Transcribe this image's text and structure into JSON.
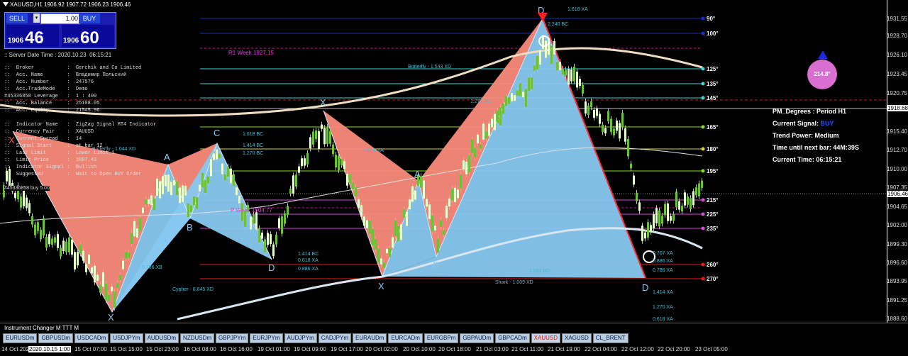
{
  "window": {
    "title": "XAUUSD,H1  1906.92 1907.72 1906.23 1906.46"
  },
  "trade_panel": {
    "sell_label": "SELL",
    "buy_label": "BUY",
    "lot": "1.00",
    "sell_small": "1906",
    "sell_big": "46",
    "buy_small": "1906",
    "buy_big": "60"
  },
  "info": {
    "server": ":: Server Date Time : 2020.10.23  06:15:21",
    "lines": [
      "::  Broker           :  Gerchik and Co Limited",
      "::  Acc. Name        :  Владимир Польский",
      "::  Acc. Number      :  247576",
      "::  Acc.TradeMode    :  Demo",
      "#45336858 Leverage   :  1 : 400",
      "::  Acc. Balance     :  25108.05",
      "::  Acc. Equity      :  21545.96",
      "",
      "::  Indicator Name   :  ZigZag Signal MT4 Indicator",
      "::  Currency Pair    :  XAUUSD",
      "::  Current Spread   :  14",
      "::  Signal Start     :  at bar 12",
      "::  Last Limit       :  Lower Limit_1",
      "::  Limit Price      :  1897.43",
      "::  Indicator Signal :  Bullish",
      "::  Suggested        :  Wait to Open BUY Order"
    ],
    "order": "#45336858 buy 5.00"
  },
  "pm_panel": {
    "degrees": "PM_Degrees : Period H1",
    "signal_label": "Current Signal:",
    "signal_value": "BUY",
    "trend": "Trend Power: Medium",
    "next_bar": "Time until next bar: 44M:39S",
    "current_time": "Current Time: 06:15:21",
    "circle": "214.8°"
  },
  "levels": [
    "90°",
    "100°",
    "125°",
    "135°",
    "145°",
    "165°",
    "180°",
    "195°",
    "215°",
    "225°",
    "235°",
    "260°",
    "270°"
  ],
  "price_axis": {
    "labels": [
      "1931.55",
      "1928.70",
      "1926.10",
      "1923.45",
      "1920.75",
      "1918.68",
      "1915.40",
      "1912.70",
      "1910.00",
      "1907.35",
      "1906.46",
      "1904.65",
      "1902.00",
      "1899.30",
      "1896.60",
      "1893.95",
      "1891.25",
      "1888.60"
    ],
    "current": "1906.46",
    "highlight": "1918.68"
  },
  "annotations": {
    "r1_week": "R1 Week  1927.15",
    "p_week": "P Week  1904.77",
    "x1": "X",
    "a1": "A",
    "b1": "B",
    "c1": "C",
    "d1": "D",
    "x2": "X",
    "a2": "A",
    "b2": "B",
    "d2": "D",
    "d3": "D",
    "butterfly1": "Butterfly - 1.044 XD",
    "butterfly2": "Butterfly - 1.543 XD",
    "cypher": "Cypher - 0.645 XD",
    "shark": "Shark - 1.009 XD",
    "r1": "1.618 BC",
    "r2": "1.414 BC",
    "r3": "1.270 BC",
    "r4": "0.786 XB",
    "r5": "1.414 BC",
    "r6": "0.618 XA",
    "r7": "0.886 XA",
    "r8": "0.786 XA",
    "r9": "1.270 XA",
    "r10": "1.618 XA",
    "r11": "2.240 BC",
    "r12": "1.091 BD",
    "r13": "0.707 XA",
    "r14": "0.886 XA",
    "r15": "1.414 XA",
    "r16": "1.270 XA",
    "r17": "1.618 XA",
    "r18": "0.618 XA",
    "r19": "1.272 AC"
  },
  "changer": {
    "label": "Instrument Changer M TTT M"
  },
  "tabs": [
    "EURUSDm",
    "GBPUSDm",
    "USDCADm",
    "USDJPYm",
    "AUDUSDm",
    "NZDUSDm",
    "GBPJPYm",
    "EURJPYm",
    "AUDJPYm",
    "CADJPYm",
    "EURAUDm",
    "EURCADm",
    "EURGBPm",
    "GBPAUDm",
    "GBPCADm",
    "XAUUSD",
    "XAGUSD",
    "CL_BRENT"
  ],
  "time_axis": [
    "14 Oct 2020",
    "2020.10.15 1:00",
    "15 Oct 07:00",
    "15 Oct 15:00",
    "15 Oct 23:00",
    "16 Oct 08:00",
    "16 Oct 16:00",
    "19 Oct 01:00",
    "19 Oct 09:00",
    "19 Oct 17:00",
    "20 Oct 02:00",
    "20 Oct 10:00",
    "20 Oct 18:00",
    "21 Oct 03:00",
    "21 Oct 11:00",
    "21 Oct 19:00",
    "22 Oct 04:00",
    "22 Oct 12:00",
    "22 Oct 20:00",
    "23 Oct 05:00"
  ],
  "colors": {
    "bg": "#000000",
    "sell": "#fa8a7a",
    "buy": "#87c8f0",
    "candle": "#c4f28a",
    "ma_slow": "#f0dcc0",
    "ma_fast": "#d8e6f0",
    "accent": "#2050ff",
    "circle": "#d96fd0"
  }
}
